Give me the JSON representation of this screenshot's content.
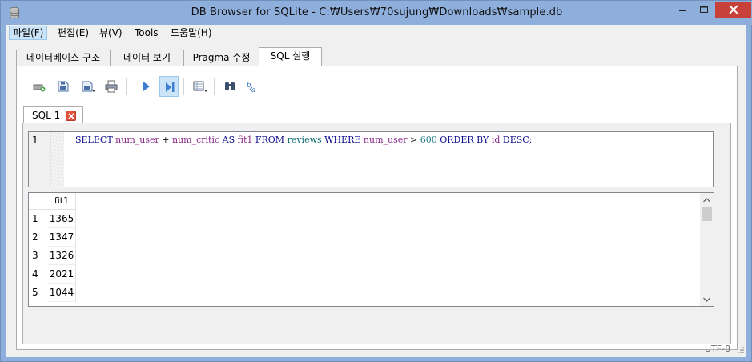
{
  "window": {
    "title": "DB Browser for SQLite - C:\\Users\\70sujung\\Downloads\\sample.db",
    "title_display": "DB Browser for SQLite - C:₩Users₩70sujung₩Downloads₩sample.db"
  },
  "menu": {
    "items": [
      {
        "label": "파일(F)",
        "accel": "F"
      },
      {
        "label": "편집(E)",
        "accel": "E"
      },
      {
        "label": "뷰(V)",
        "accel": "V"
      },
      {
        "label": "Tools",
        "accel": "T"
      },
      {
        "label": "도움말(H)",
        "accel": "H"
      }
    ]
  },
  "main_tabs": [
    {
      "label": "데이터베이스 구조"
    },
    {
      "label": "데이터 보기"
    },
    {
      "label": "Pragma 수정"
    },
    {
      "label": "SQL 실행",
      "selected": true
    }
  ],
  "toolbar": {
    "buttons": [
      {
        "icon": "open-tab-icon"
      },
      {
        "icon": "open-sql-file-icon"
      },
      {
        "icon": "save-sql-file-icon"
      },
      {
        "icon": "print-icon"
      },
      {
        "icon": "execute-all-icon"
      },
      {
        "icon": "execute-current-line-icon",
        "pressed": true
      },
      {
        "icon": "save-results-icon"
      },
      {
        "icon": "find-icon"
      },
      {
        "icon": "find-replace-icon"
      }
    ]
  },
  "sql_tab": {
    "label": "SQL 1"
  },
  "editor": {
    "line_number": "1",
    "tokens": [
      {
        "t": "SELECT",
        "c": "kw"
      },
      {
        "t": " ",
        "c": "op"
      },
      {
        "t": "num_user",
        "c": "id"
      },
      {
        "t": " + ",
        "c": "op"
      },
      {
        "t": "num_critic",
        "c": "id"
      },
      {
        "t": " ",
        "c": "op"
      },
      {
        "t": "AS",
        "c": "kw"
      },
      {
        "t": " ",
        "c": "op"
      },
      {
        "t": "fit1",
        "c": "id"
      },
      {
        "t": " ",
        "c": "op"
      },
      {
        "t": "FROM",
        "c": "kw"
      },
      {
        "t": " ",
        "c": "op"
      },
      {
        "t": "reviews",
        "c": "tbl"
      },
      {
        "t": " ",
        "c": "op"
      },
      {
        "t": "WHERE",
        "c": "kw"
      },
      {
        "t": " ",
        "c": "op"
      },
      {
        "t": "num_user",
        "c": "id"
      },
      {
        "t": " > ",
        "c": "op"
      },
      {
        "t": "600",
        "c": "num"
      },
      {
        "t": " ",
        "c": "op"
      },
      {
        "t": "ORDER",
        "c": "kw"
      },
      {
        "t": " ",
        "c": "op"
      },
      {
        "t": "BY",
        "c": "kw"
      },
      {
        "t": " ",
        "c": "op"
      },
      {
        "t": "id",
        "c": "id"
      },
      {
        "t": " ",
        "c": "op"
      },
      {
        "t": "DESC;",
        "c": "kw"
      }
    ]
  },
  "results": {
    "columns": [
      "fit1"
    ],
    "rows": [
      {
        "num": "1",
        "fit1": "1365"
      },
      {
        "num": "2",
        "fit1": "1347"
      },
      {
        "num": "3",
        "fit1": "1326"
      },
      {
        "num": "4",
        "fit1": "2021"
      },
      {
        "num": "5",
        "fit1": "1044"
      }
    ]
  },
  "status": {
    "encoding": "UTF-8"
  },
  "colors": {
    "titlebar": "#8eaedb",
    "close_button": "#c7403a",
    "keyword": "#0b0b8f",
    "identifier": "#8a2a8a",
    "table_name": "#0b6e6e",
    "number": "#1a7a86"
  }
}
